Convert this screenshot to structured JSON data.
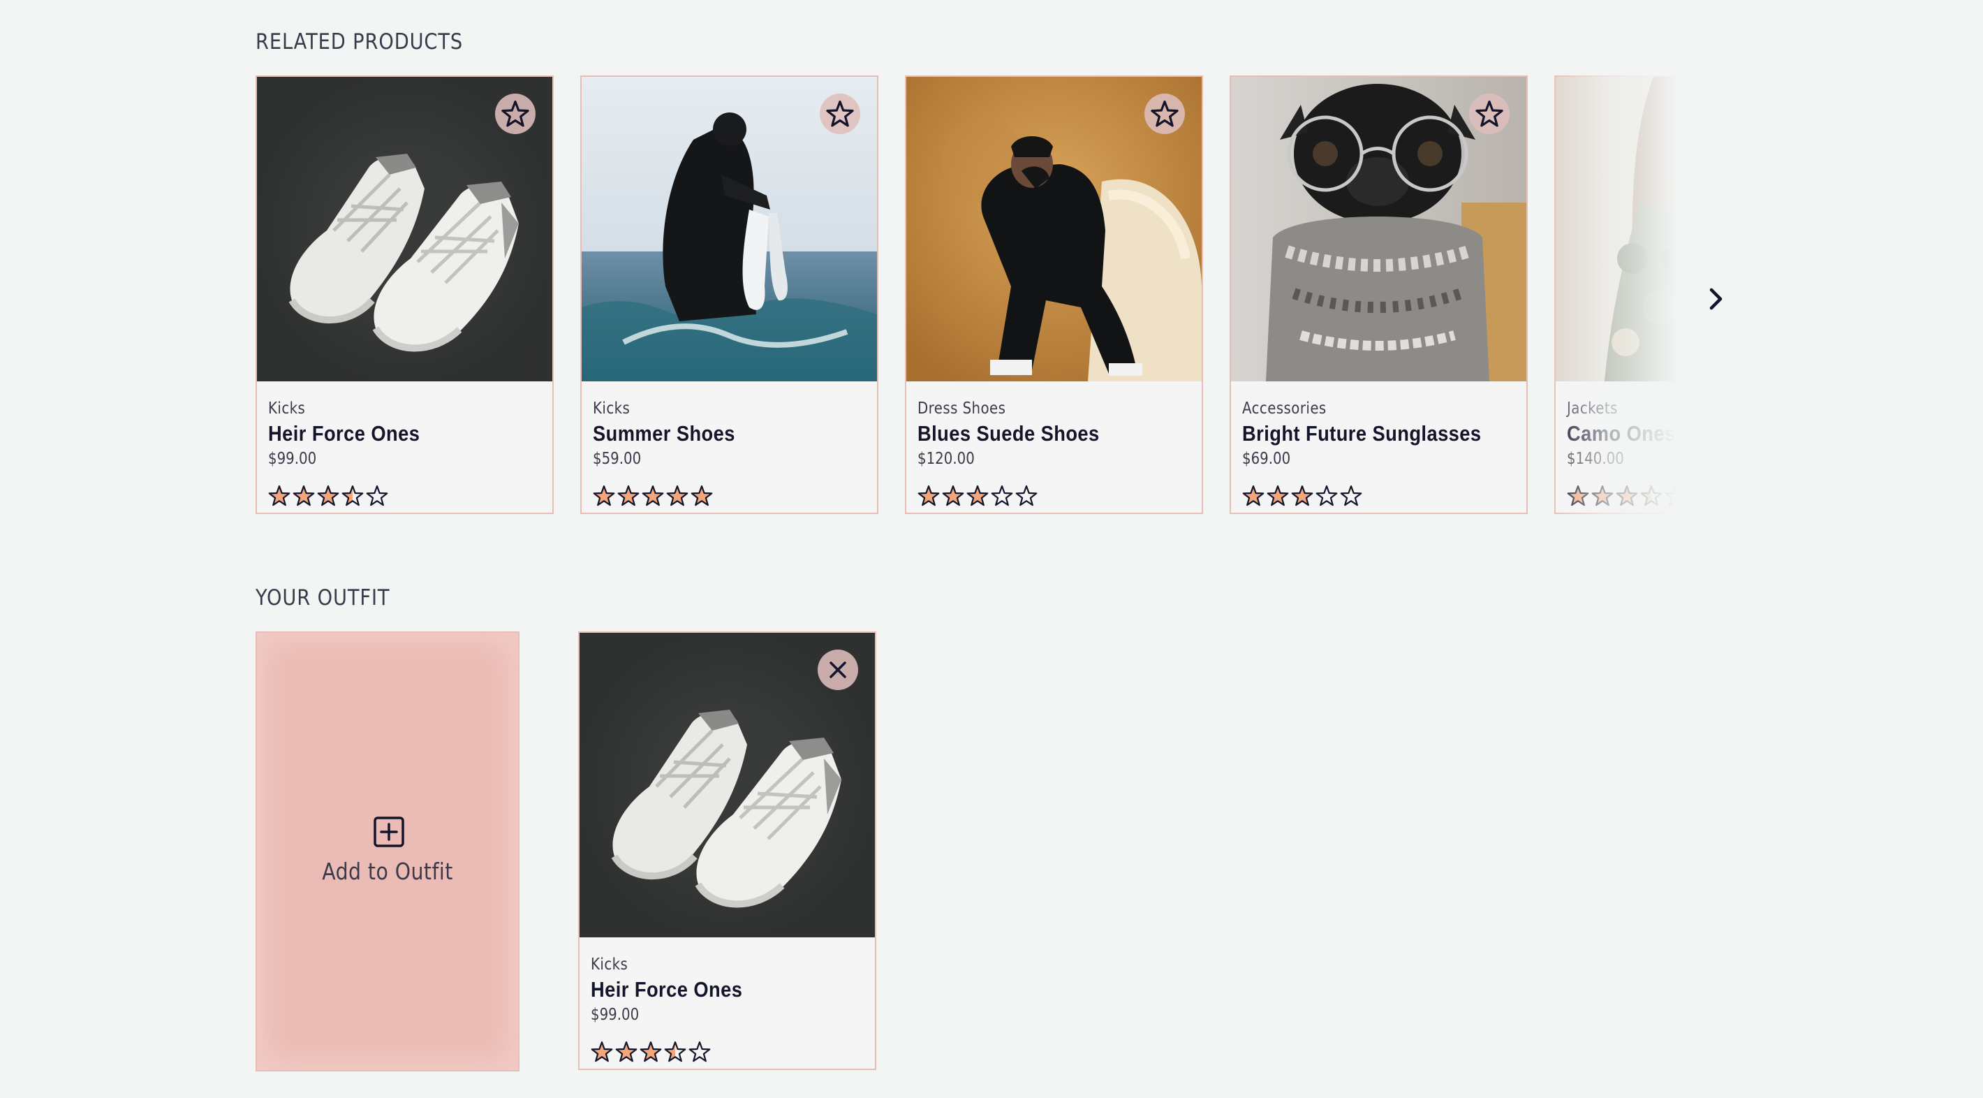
{
  "related": {
    "title": "RELATED PRODUCTS",
    "items": [
      {
        "category": "Kicks",
        "name": "Heir Force Ones",
        "price": "$99.00",
        "rating": 3.5,
        "image": "white-sneakers"
      },
      {
        "category": "Kicks",
        "name": "Summer Shoes",
        "price": "$59.00",
        "rating": 5,
        "image": "man-in-water-holding-sneakers"
      },
      {
        "category": "Dress Shoes",
        "name": "Blues Suede Shoes",
        "price": "$120.00",
        "rating": 3,
        "image": "man-in-black-on-fur-chair"
      },
      {
        "category": "Accessories",
        "name": "Bright Future Sunglasses",
        "price": "$69.00",
        "rating": 3,
        "image": "pug-in-glasses-and-scarf"
      },
      {
        "category": "Jackets",
        "name": "Camo Onesie",
        "price": "$140.00",
        "rating": 3.5,
        "image": "person-in-camo-jacket"
      }
    ],
    "action_icon": "star-outline-icon",
    "next_icon": "chevron-right-icon"
  },
  "outfit": {
    "title": "YOUR OUTFIT",
    "add_label": "Add to Outfit",
    "add_icon": "plus-square-icon",
    "items": [
      {
        "category": "Kicks",
        "name": "Heir Force Ones",
        "price": "$99.00",
        "rating": 3.5,
        "image": "white-sneakers"
      }
    ],
    "remove_icon": "close-icon"
  },
  "colors": {
    "background": "#f3f5f4",
    "card_border": "#e8bdb5",
    "star_fill": "#f2a67a",
    "star_stroke": "#14142b",
    "add_tile": "#ebbcb5",
    "action_button": "#debebc"
  }
}
